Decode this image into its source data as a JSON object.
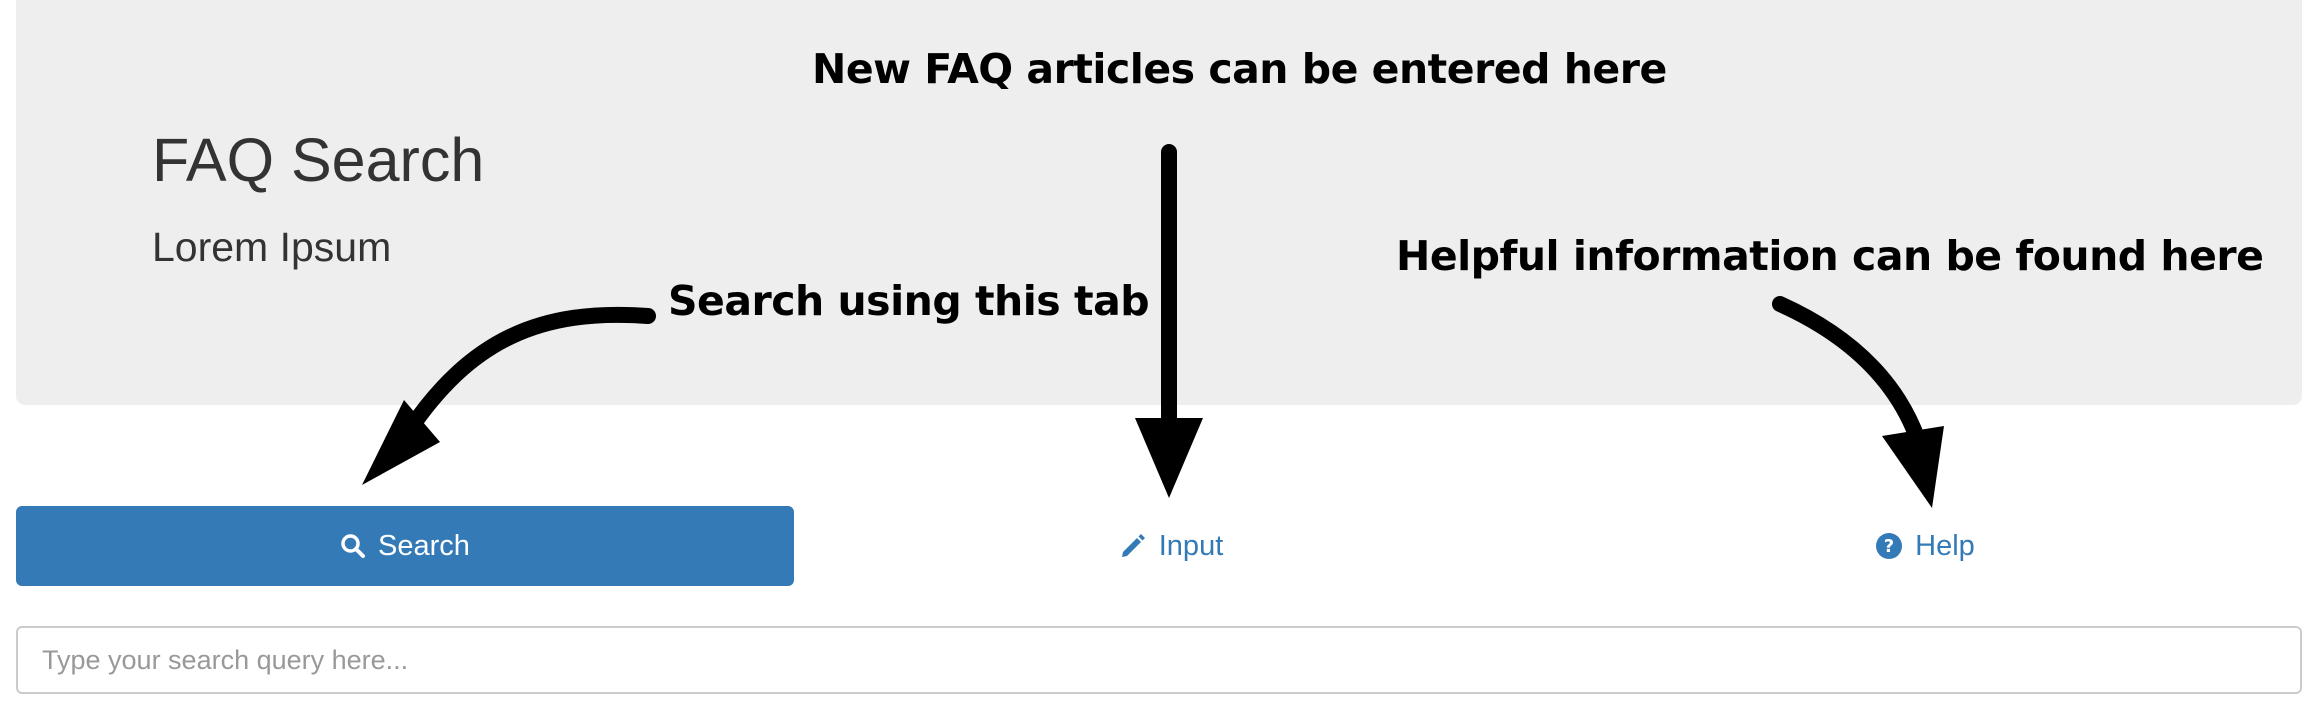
{
  "header": {
    "title": "FAQ Search",
    "subtitle": "Lorem Ipsum"
  },
  "annotations": {
    "input_note": "New FAQ articles can be entered here",
    "help_note": "Helpful information can be found here",
    "search_note": "Search using this tab"
  },
  "tabs": [
    {
      "label": "Search",
      "icon": "search-icon",
      "active": true
    },
    {
      "label": "Input",
      "icon": "pencil-icon",
      "active": false
    },
    {
      "label": "Help",
      "icon": "question-circle-icon",
      "active": false
    }
  ],
  "search": {
    "value": "",
    "placeholder": "Type your search query here..."
  },
  "colors": {
    "primary": "#337ab7",
    "jumbotron_bg": "#eeeeee",
    "text": "#333333",
    "annotation": "#000000"
  }
}
